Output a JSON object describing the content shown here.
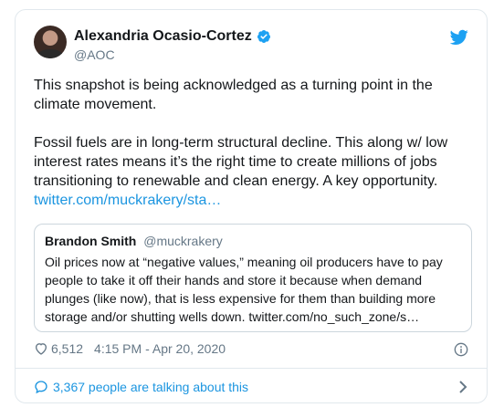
{
  "author": {
    "name": "Alexandria Ocasio-Cortez",
    "handle": "@AOC",
    "verified": true
  },
  "tweet": {
    "line1": "This snapshot is being acknowledged as a turning point in the climate movement.",
    "line2": "Fossil fuels are in long-term structural decline. This along w/ low interest rates means it’s the right time to create millions of jobs transitioning to renewable and clean energy. A key opportunity.",
    "link": "twitter.com/muckrakery/sta…"
  },
  "quoted_tweet": {
    "name": "Brandon Smith",
    "handle": "@muckrakery",
    "text": "Oil prices now at “negative values,” meaning oil producers have to pay people to take it off their hands and store it because when demand plunges (like now), that is less expensive for them than building more storage and/or shutting wells down. twitter.com/no_such_zone/s…"
  },
  "meta": {
    "likes": "6,512",
    "timestamp": "4:15 PM - Apr 20, 2020"
  },
  "footer": {
    "conversation": "3,367 people are talking about this"
  },
  "colors": {
    "accent": "#1b95e0",
    "secondary_text": "#657786",
    "border": "#e1e8ed"
  },
  "icons": [
    "verified-badge-icon",
    "twitter-bird-icon",
    "heart-icon",
    "info-icon",
    "speech-bubble-icon",
    "chevron-right-icon"
  ]
}
